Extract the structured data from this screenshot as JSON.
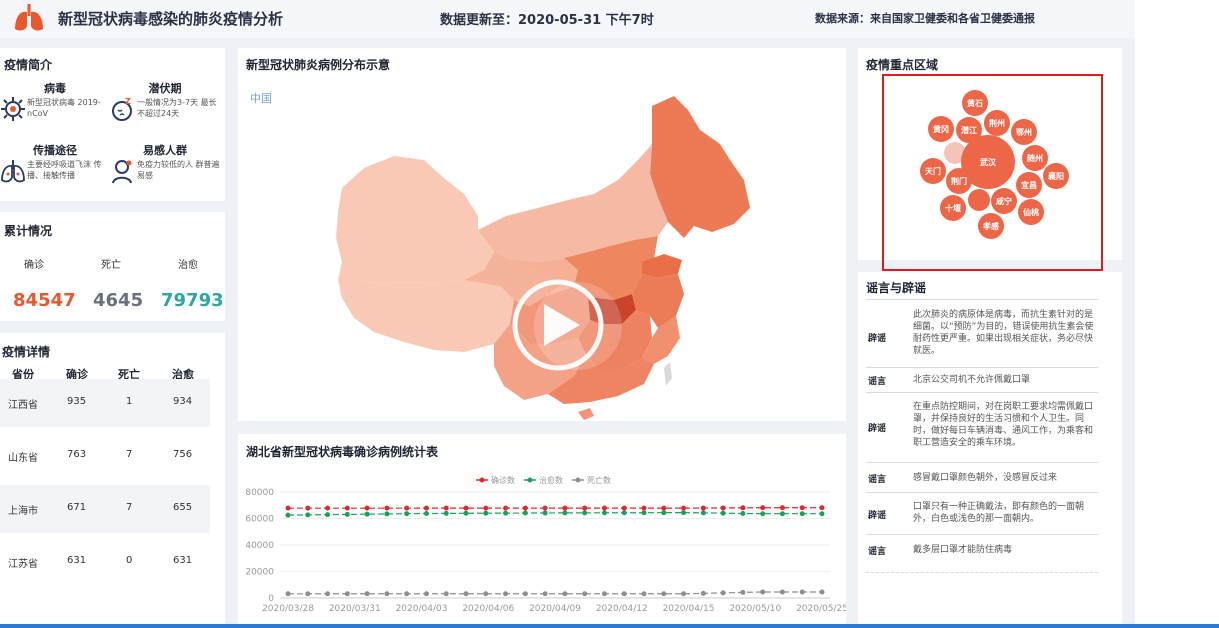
{
  "header": {
    "title": "新型冠状病毒感染的肺炎疫情分析",
    "update": "数据更新至：2020-05-31 下午7时",
    "source": "数据来源：来自国家卫健委和各省卫健委通报"
  },
  "intro": {
    "title": "疫情简介",
    "items": [
      {
        "heading": "病毒",
        "text": "新型冠状病毒 2019-nCoV",
        "icon": "virus-icon"
      },
      {
        "heading": "潜伏期",
        "text": "一般情况为3-7天 最长不超过24天",
        "icon": "sleep-face-icon"
      },
      {
        "heading": "传播途径",
        "text": "主要经呼吸道飞沫 传播、接触传播",
        "icon": "lungs-icon"
      },
      {
        "heading": "易感人群",
        "text": "免疫力较低的人 群普遍易感",
        "icon": "person-icon"
      }
    ]
  },
  "totals": {
    "title": "累计情况",
    "confirmed_label": "确诊",
    "confirmed": "84547",
    "death_label": "死亡",
    "death": "4645",
    "cured_label": "治愈",
    "cured": "79793"
  },
  "detail": {
    "title": "疫情详情",
    "headers": [
      "省份",
      "确诊",
      "死亡",
      "治愈"
    ],
    "rows": [
      [
        "江西省",
        "935",
        "1",
        "934"
      ],
      [
        "山东省",
        "763",
        "7",
        "756"
      ],
      [
        "上海市",
        "671",
        "7",
        "655"
      ],
      [
        "江苏省",
        "631",
        "0",
        "631"
      ]
    ]
  },
  "map": {
    "title": "新型冠状肺炎病例分布示意",
    "label": "中国"
  },
  "chart_data": {
    "type": "line",
    "title": "湖北省新型冠状病毒确诊病例统计表",
    "legend": [
      "确诊数",
      "治愈数",
      "死亡数"
    ],
    "x": [
      "2020/03/28",
      "2020/03/31",
      "2020/04/03",
      "2020/04/06",
      "2020/04/09",
      "2020/04/12",
      "2020/04/15",
      "2020/05/10",
      "2020/05/25"
    ],
    "ylim": [
      0,
      80000
    ],
    "yticks": [
      "80000",
      "60000",
      "40000",
      "20000",
      "0"
    ],
    "series": [
      {
        "name": "确诊数",
        "color": "#e0272b",
        "values": [
          67801,
          67801,
          67802,
          67803,
          67803,
          67803,
          67803,
          68128,
          68134
        ]
      },
      {
        "name": "治愈数",
        "color": "#1aa05a",
        "values": [
          62570,
          63153,
          63762,
          64014,
          64216,
          64338,
          64435,
          63616,
          63616
        ]
      },
      {
        "name": "死亡数",
        "color": "#8e8e8e",
        "values": [
          3177,
          3186,
          3199,
          3212,
          3213,
          3219,
          3222,
          4512,
          4512
        ]
      }
    ]
  },
  "bubbles": {
    "title": "疫情重点区域",
    "cities": [
      "黄石",
      "黄冈",
      "潜江",
      "荆州",
      "鄂州",
      "武汉",
      "随州",
      "天门",
      "荆门",
      "宜昌",
      "襄阳",
      "十堰",
      "咸宁",
      "仙桃",
      "孝感"
    ]
  },
  "rumor": {
    "title": "谣言与辟谣",
    "items": [
      {
        "tag": "辟谣",
        "text": "此次肺炎的病原体是病毒，而抗生素针对的是细菌。以“预防”为目的，错误使用抗生素会使耐药性更严重。如果出现相关症状，务必尽快就医。"
      },
      {
        "tag": "谣言",
        "text": "北京公交司机不允许佩戴口罩"
      },
      {
        "tag": "辟谣",
        "text": "在重点防控期间，对在岗职工要求均需佩戴口罩，并保持良好的生活习惯和个人卫生。同时，做好每日车辆消毒、通风工作，为乘客和职工营造安全的乘车环境。"
      },
      {
        "tag": "谣言",
        "text": "感冒戴口罩颜色朝外，没感冒反过来"
      },
      {
        "tag": "辟谣",
        "text": "口罩只有一种正确戴法，即有颜色的一面朝外，白色或浅色的那一面朝内。"
      },
      {
        "tag": "谣言",
        "text": "戴多层口罩才能防住病毒"
      }
    ]
  }
}
